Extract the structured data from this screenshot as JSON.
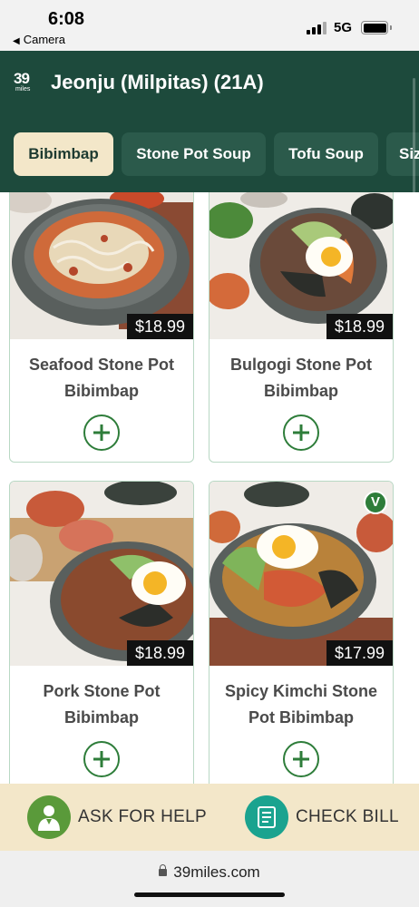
{
  "status_bar": {
    "time": "6:08",
    "back_label": "Camera",
    "network": "5G"
  },
  "header": {
    "logo_number": "39",
    "logo_word": "miles",
    "title": "Jeonju (Milpitas) (21A)"
  },
  "tabs": [
    {
      "label": "Bibimbap",
      "active": true
    },
    {
      "label": "Stone Pot Soup",
      "active": false
    },
    {
      "label": "Tofu Soup",
      "active": false
    },
    {
      "label": "Sizzling",
      "active": false
    }
  ],
  "menu_items": [
    {
      "name": "Seafood Stone Pot Bibimbap",
      "price": "$18.99",
      "vegetarian": false
    },
    {
      "name": "Bulgogi Stone Pot Bibimbap",
      "price": "$18.99",
      "vegetarian": false
    },
    {
      "name": "Pork Stone Pot Bibimbap",
      "price": "$18.99",
      "vegetarian": false
    },
    {
      "name": "Spicy Kimchi Stone Pot Bibimbap",
      "price": "$17.99",
      "vegetarian": true,
      "badge": "V"
    }
  ],
  "actions": {
    "help_label": "ASK FOR HELP",
    "bill_label": "CHECK BILL"
  },
  "browser": {
    "url": "39miles.com"
  },
  "colors": {
    "header_bg": "#1d4a3c",
    "tab_active_bg": "#f3e7c9",
    "accent_green": "#2e7d3a",
    "help_icon_bg": "#5a9a3a",
    "bill_icon_bg": "#1aa38f"
  }
}
